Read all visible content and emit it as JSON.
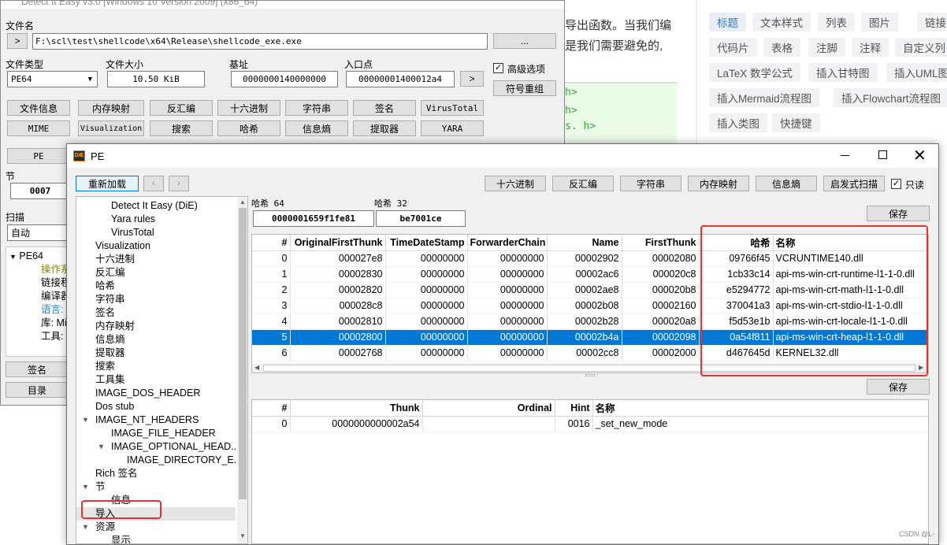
{
  "back_window": {
    "title": "Detect It Easy v3.0 [Windows 10 Version 2009] (x86_64)",
    "file_name_label": "文件名",
    "browse_btn": ">",
    "file_path": "F:\\scl\\test\\shellcode\\x64\\Release\\shellcode_exe.exe",
    "dots_btn": "...",
    "file_type_label": "文件类型",
    "file_type_value": "PE64",
    "file_size_label": "文件大小",
    "file_size_value": "10.50 KiB",
    "base_label": "基址",
    "base_value": "0000000140000000",
    "entry_label": "入口点",
    "entry_value": "00000001400012a4",
    "entry_btn": ">",
    "advanced_label": "高级选项",
    "sig_reload_btn": "符号重组",
    "row1_buttons": [
      "文件信息",
      "内存映射",
      "反汇编",
      "十六进制",
      "字符串",
      "签名",
      "VirusTotal"
    ],
    "row2_buttons": [
      "MIME",
      "Visualization",
      "搜索",
      "哈希",
      "信息熵",
      "提取器",
      "YARA"
    ],
    "pe_btn": "PE",
    "section_label": "节",
    "section_value": "0007",
    "scan_label": "扫描",
    "scan_value": "自动",
    "tree_root": "PE64",
    "tree_children": [
      "操作系",
      "链接程",
      "编译器",
      "语言: C",
      "库: Mi",
      "工具: V"
    ],
    "signature_btn": "签名",
    "dir_btn": "目录"
  },
  "article": {
    "text_line1": "导出函数。当我们编",
    "text_line2": "是我们需要避免的,",
    "code_lines": [
      "h>",
      "h>",
      "s. h>"
    ],
    "tags": [
      {
        "label": "标题",
        "active": true
      },
      {
        "label": "文本样式"
      },
      {
        "label": "列表"
      },
      {
        "label": "图片"
      },
      {
        "label": "链接"
      },
      {
        "label": "代码片"
      },
      {
        "label": "表格"
      },
      {
        "label": "注脚"
      },
      {
        "label": "注释"
      },
      {
        "label": "自定义列"
      },
      {
        "label": "LaTeX 数学公式"
      },
      {
        "label": "插入甘特图"
      },
      {
        "label": "插入UML图"
      },
      {
        "label": "插入Mermaid流程图"
      },
      {
        "label": "插入Flowchart流程图"
      },
      {
        "label": "插入类图"
      },
      {
        "label": "快捷键"
      }
    ]
  },
  "pe_window": {
    "title": "PE",
    "app_icon_text": "DiE",
    "reload_btn": "重新加载",
    "toolbar_buttons": [
      "十六进制",
      "反汇编",
      "字符串",
      "内存映射",
      "信息熵",
      "启发式扫描"
    ],
    "readonly_label": "只读",
    "hash64_label": "哈希 64",
    "hash64_value": "0000001659f1fe81",
    "hash32_label": "哈希 32",
    "hash32_value": "be7001ce",
    "save_btn": "保存",
    "tree": [
      {
        "label": "Detect It Easy (DiE)",
        "level": 2
      },
      {
        "label": "Yara rules",
        "level": 2
      },
      {
        "label": "VirusTotal",
        "level": 2
      },
      {
        "label": "Visualization",
        "level": 1
      },
      {
        "label": "十六进制",
        "level": 1
      },
      {
        "label": "反汇编",
        "level": 1
      },
      {
        "label": "哈希",
        "level": 1
      },
      {
        "label": "字符串",
        "level": 1
      },
      {
        "label": "签名",
        "level": 1
      },
      {
        "label": "内存映射",
        "level": 1
      },
      {
        "label": "信息熵",
        "level": 1
      },
      {
        "label": "提取器",
        "level": 1
      },
      {
        "label": "搜索",
        "level": 1
      },
      {
        "label": "工具集",
        "level": 1
      },
      {
        "label": "IMAGE_DOS_HEADER",
        "level": 1
      },
      {
        "label": "Dos stub",
        "level": 1
      },
      {
        "label": "IMAGE_NT_HEADERS",
        "level": 1,
        "expander": "v"
      },
      {
        "label": "IMAGE_FILE_HEADER",
        "level": 2
      },
      {
        "label": "IMAGE_OPTIONAL_HEAD...",
        "level": 2,
        "expander": "v"
      },
      {
        "label": "IMAGE_DIRECTORY_E...",
        "level": 3
      },
      {
        "label": "Rich 签名",
        "level": 1
      },
      {
        "label": "节",
        "level": 1,
        "expander": "v"
      },
      {
        "label": "信息",
        "level": 2
      },
      {
        "label": "导入",
        "level": 1,
        "selected": true
      },
      {
        "label": "资源",
        "level": 1,
        "expander": "v"
      },
      {
        "label": "显示",
        "level": 2
      }
    ],
    "imports_table": {
      "columns": [
        "#",
        "OriginalFirstThunk",
        "TimeDateStamp",
        "ForwarderChain",
        "Name",
        "FirstThunk",
        "哈希",
        "名称"
      ],
      "rows": [
        [
          "0",
          "000027e8",
          "00000000",
          "00000000",
          "00002902",
          "00002080",
          "09766f45",
          "VCRUNTIME140.dll"
        ],
        [
          "1",
          "00002830",
          "00000000",
          "00000000",
          "00002ac6",
          "000020c8",
          "1cb33c14",
          "api-ms-win-crt-runtime-l1-1-0.dll"
        ],
        [
          "2",
          "00002820",
          "00000000",
          "00000000",
          "00002ae8",
          "000020b8",
          "e5294772",
          "api-ms-win-crt-math-l1-1-0.dll"
        ],
        [
          "3",
          "000028c8",
          "00000000",
          "00000000",
          "00002b08",
          "00002160",
          "370041a3",
          "api-ms-win-crt-stdio-l1-1-0.dll"
        ],
        [
          "4",
          "00002810",
          "00000000",
          "00000000",
          "00002b28",
          "000020a8",
          "f5d53e1b",
          "api-ms-win-crt-locale-l1-1-0.dll"
        ],
        [
          "5",
          "00002800",
          "00000000",
          "00000000",
          "00002b4a",
          "00002098",
          "0a54f811",
          "api-ms-win-crt-heap-l1-1-0.dll"
        ],
        [
          "6",
          "00002768",
          "00000000",
          "00000000",
          "00002cc8",
          "00002000",
          "d467645d",
          "KERNEL32.dll"
        ]
      ],
      "selected_row": 5
    },
    "functions_table": {
      "columns": [
        "#",
        "Thunk",
        "Ordinal",
        "Hint",
        "名称"
      ],
      "rows": [
        [
          "0",
          "0000000000002a54",
          "",
          "0016",
          "_set_new_mode"
        ]
      ]
    },
    "watermark": "CSDN @L-"
  },
  "colors": {
    "highlight_red": "#e8322f",
    "selection_blue": "#0078d7",
    "tag_blue": "#2a7ae2"
  }
}
